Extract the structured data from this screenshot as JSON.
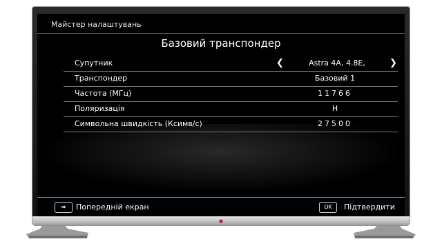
{
  "header": {
    "wizard_title": "Майстер налаштувань"
  },
  "page": {
    "title": "Базовий транспондер"
  },
  "settings": [
    {
      "label": "Супутник",
      "value": "Astra 4A, 4.8E,"
    },
    {
      "label": "Транспондер",
      "value": "Базовий 1"
    },
    {
      "label": "Частота (МГц)",
      "value": "11766"
    },
    {
      "label": "Поляризація",
      "value": "H"
    },
    {
      "label": "Символьна швидкість (Ксимв/с)",
      "value": "27500"
    }
  ],
  "footer": {
    "back_label": "Попередній екран",
    "ok_key": "OK",
    "confirm_label": "Підтвердити"
  },
  "icons": {
    "prev_arrow": "chevron-left-icon",
    "next_arrow": "chevron-right-icon",
    "back": "back-arrow-icon"
  }
}
